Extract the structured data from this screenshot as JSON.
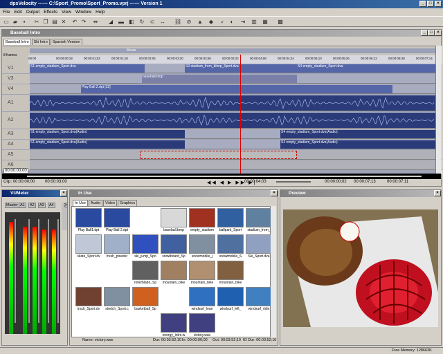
{
  "window": {
    "title": "dpsVelocity ------ C:\\Sport_Promo\\Sport_Promo.vprj ------ Version 1"
  },
  "menu": [
    "File",
    "Edit",
    "Output",
    "Effects",
    "View",
    "Window",
    "Help"
  ],
  "timeline": {
    "title": "Baseball Intro",
    "tabs": [
      "Baseball Intro",
      "Ski Intro",
      "Spanish Version"
    ],
    "frames_label": "8 frames",
    "marker_label": "Movie",
    "ruler": [
      "00:00",
      "00:00:00;18",
      "00:00:01;02",
      "00:00:01;18",
      "00:00:02;04",
      "00:00:02;20",
      "00:00:03;06",
      "00:00:03;22",
      "00:00:04;08",
      "00:00:04;24",
      "00:00:05;10",
      "00:00:05;26",
      "00:00:06;12",
      "00:00:06;28",
      "00:00:07;14"
    ],
    "tracks": [
      {
        "name": "V1",
        "clips": [
          {
            "label": "S1 empty_stadium_Sport.dva"
          },
          {
            "label": "S3 stadium_from_blimp_Sport.dva"
          },
          {
            "label": "S4 empty_stadium_Sport.dva"
          }
        ],
        "chevrons": "-[0]-"
      },
      {
        "name": "V3",
        "clips": [
          {
            "label": "baseball.bmp"
          }
        ]
      },
      {
        "name": "V4",
        "clips": [
          {
            "label": "Play Ball 2.dpt [32]"
          }
        ]
      },
      {
        "name": "A1"
      },
      {
        "name": "A2"
      },
      {
        "name": "A3",
        "clips": [
          {
            "label": "S1 empty_stadium_Sport.dva(Audio)"
          },
          {
            "label": "S4 empty_stadium_Sport.dva(Audio)"
          }
        ]
      },
      {
        "name": "A4",
        "clips": [
          {
            "label": "S1 empty_stadium_Sport.dva(Audio)"
          },
          {
            "label": "S4 empty_stadium_Sport.dva(Audio)"
          }
        ]
      },
      {
        "name": "A5"
      },
      {
        "name": "A6"
      }
    ],
    "timecode": "00:00:00;00",
    "clip_label": "Clip: 00:00:00;00",
    "out_label": "00:00:03;00",
    "current": "00:00:04;03",
    "dur1": "00:00:00;02",
    "dur2": "00:00:07;13",
    "dur3": "00:00:07;11"
  },
  "vumeter": {
    "title": "VUMeter",
    "labels": [
      "Master",
      "A1",
      "A2",
      "A3",
      "A4"
    ],
    "levels": [
      0.92,
      0.88,
      0.88,
      0.86,
      0.86
    ]
  },
  "inuse": {
    "title": "In Use",
    "tabs": [
      "In Use",
      "Audio",
      "Video",
      "Graphics"
    ],
    "items": [
      "Play Ball1.dpt",
      "Play Ball 2.dpt",
      "",
      "baseball.bmp",
      "empty_stadium",
      "ballpark_Sport",
      "stadium_from_",
      "skate_Sport.dv",
      "fresh_powder",
      "ski_jump_Spo",
      "snowboard_Sp",
      "snowmobile_j",
      "snowmobile_S",
      "Ski_Sport.dva",
      "",
      "",
      "rollerblade_Sp",
      "mountain_bike",
      "mountain_bike",
      "mountain_bike",
      "",
      "track_Sport.dv",
      "stretch_Sport.c",
      "basketball_Sp",
      "",
      "windsurf_lean",
      "windsurf_left_",
      "windsurf_ridin",
      "",
      "",
      "",
      "energy_intro.w",
      "victory.wav",
      "",
      ""
    ],
    "footer": {
      "name": "Name: victory.wav",
      "dur": "Dur: 00:03:52;10",
      "in": "In: 00:00:00;00",
      "out": "Out: 00:03:52;10",
      "io": "IO Dur: 00:03:52;10"
    }
  },
  "preview": {
    "title": "Preview"
  },
  "status": {
    "free_memory": "Free Memory: 128663K"
  }
}
